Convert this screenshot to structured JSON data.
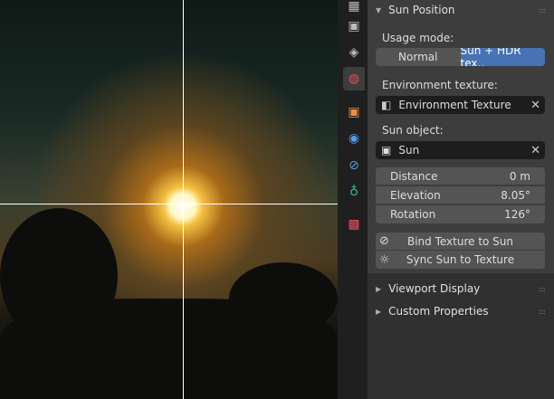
{
  "panel": {
    "title": "Sun Position",
    "usage_mode_label": "Usage mode:",
    "usage_modes": [
      "Normal",
      "Sun + HDR tex.."
    ],
    "active_mode": 1,
    "env_texture_label": "Environment texture:",
    "env_texture_value": "Environment Texture",
    "sun_object_label": "Sun object:",
    "sun_object_value": "Sun",
    "props": [
      {
        "label": "Distance",
        "value": "0 m"
      },
      {
        "label": "Elevation",
        "value": "8.05°"
      },
      {
        "label": "Rotation",
        "value": "126°"
      }
    ],
    "bind_button": "Bind Texture to Sun",
    "sync_button": "Sync Sun to Texture",
    "subpanels": [
      "Viewport Display",
      "Custom Properties"
    ]
  },
  "colors": {
    "accent": "#4772b3",
    "world_tab": "#e05060"
  }
}
